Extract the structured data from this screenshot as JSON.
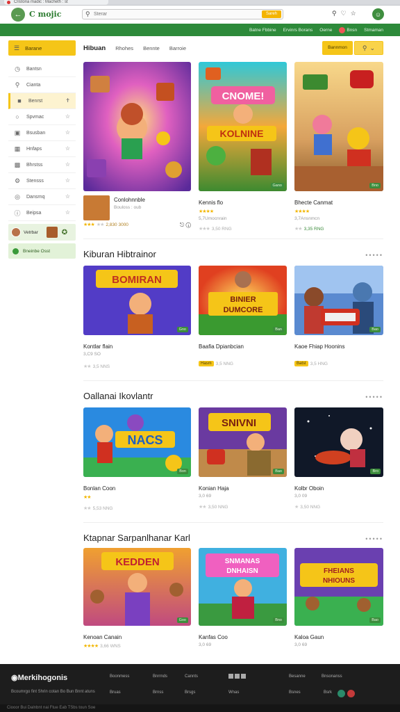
{
  "browser": {
    "tab_title": "Cristoria madic : Macheth : st",
    "url_placeholder": "Sterar",
    "go_label": "Sareh"
  },
  "header": {
    "brand": "C mojic",
    "top_icons": [
      "⚲",
      "♡",
      "☆",
      "☺"
    ]
  },
  "greenbar": {
    "links": [
      "Batne Fbbine",
      "Ervinrs Borans",
      "Oerne",
      "Bnsn",
      "Stmaman"
    ]
  },
  "sidebar": {
    "head_label": "Barane",
    "items": [
      {
        "label": "Bantsn",
        "icon": "clock-icon",
        "has_star": false
      },
      {
        "label": "Cianta",
        "icon": "search-icon",
        "has_star": false
      },
      {
        "label": "Benrst",
        "icon": "gamepad-icon",
        "has_star": true,
        "active": true
      },
      {
        "label": "Spvmac",
        "icon": "circle-icon",
        "has_star": true
      },
      {
        "label": "Bsusban",
        "icon": "card-icon",
        "has_star": true
      },
      {
        "label": "Hnfaps",
        "icon": "cart-icon",
        "has_star": true
      },
      {
        "label": "Bhrstss",
        "icon": "chart-icon",
        "has_star": true
      },
      {
        "label": "Stensss",
        "icon": "gear-icon",
        "has_star": true
      },
      {
        "label": "Dansrnq",
        "icon": "trophy-icon",
        "has_star": true
      },
      {
        "label": "Beipsa",
        "icon": "info-icon",
        "has_star": true
      }
    ],
    "user_label": "Vetrbar",
    "cta_label": "Bneinbe Osst"
  },
  "main": {
    "tabs": [
      "Hibuan",
      "Rhohes",
      "Bennte",
      "Barroie"
    ],
    "cta_label": "Bannmon",
    "featured": [
      {
        "title": "Conlohnnble",
        "sub": "Bouloss : oub",
        "rating": "2,830 3000",
        "stars": 3
      },
      {
        "title": "Kennis flo",
        "sub": "5,7Umocnrain",
        "rating": "3,50 RNG",
        "stars": 4,
        "tag": "Gano"
      },
      {
        "title": "Bhecte Canmat",
        "sub": "3,7Ansnmcn",
        "rating": "3,35 RNG",
        "stars": 4,
        "tag": "Bno"
      }
    ],
    "sections": [
      {
        "title": "Kiburan Hibtrainor",
        "cards": [
          {
            "title": "Kontlar flain",
            "sub": "3,C9 SO",
            "rating": "3,5 NNS",
            "stars": 2,
            "tag": "Gno",
            "pill": ""
          },
          {
            "title": "Baafia Dpianbcian",
            "sub": "",
            "rating": "3,5 NNG",
            "stars": 0,
            "tag": "Ban",
            "pill": "Hasm"
          },
          {
            "title": "Kaoe Fhiap Hoonins",
            "sub": "",
            "rating": "3,5 HNG",
            "stars": 0,
            "tag": "Bao",
            "pill": "Batst"
          }
        ]
      },
      {
        "title": "Oallanai Ikovlantr",
        "cards": [
          {
            "title": "Bonlan Coon",
            "sub": "3,0 SB",
            "rating": "5,53 NNG",
            "stars": 2,
            "tag": "Bon",
            "pill": ""
          },
          {
            "title": "Konian Haja",
            "sub": "3,0 69",
            "rating": "3,50 NNG",
            "stars": 2,
            "tag": "Bao",
            "pill": ""
          },
          {
            "title": "Kolbr Oboin",
            "sub": "3,0 09",
            "rating": "3,50 NNG",
            "stars": 1,
            "tag": "Bro",
            "pill": ""
          }
        ]
      },
      {
        "title": "Ktapnar Sarpanlhanar Karl",
        "cards": [
          {
            "title": "Kenoan Canain",
            "sub": "",
            "rating": "3,66 WNS",
            "stars": 4,
            "tag": "Goo",
            "pill": ""
          },
          {
            "title": "Kanfas Coo",
            "sub": "3,0 69",
            "rating": "3,50 NNG",
            "stars": 0,
            "tag": "Bno",
            "pill": ""
          },
          {
            "title": "Kaloa Gaun",
            "sub": "3,0 69",
            "rating": "3,56 NNG",
            "stars": 0,
            "tag": "Bao",
            "pill": ""
          }
        ]
      }
    ]
  },
  "footer": {
    "logo": "Merkihogonis",
    "tagline": "Bcoumrgo fint Shrin cotan Bo Bun Bnnt atuns",
    "cols": [
      [
        "Boonmess",
        "Bruas"
      ],
      [
        "Bnrrnds",
        "Brnss"
      ],
      [
        "Cannts",
        "Brsgs"
      ],
      [
        "",
        "Wnas"
      ],
      [
        "Besanne",
        "Bsnes"
      ],
      [
        "Bnsonanss",
        "Bsrk"
      ]
    ],
    "copy": "Ciooor Bui Dalnbnt nai Ftue Eab TSbs toun Soe"
  },
  "colors": {
    "green": "#2d8a3a",
    "yellow": "#f5c518",
    "footer": "#1d1d1d"
  }
}
